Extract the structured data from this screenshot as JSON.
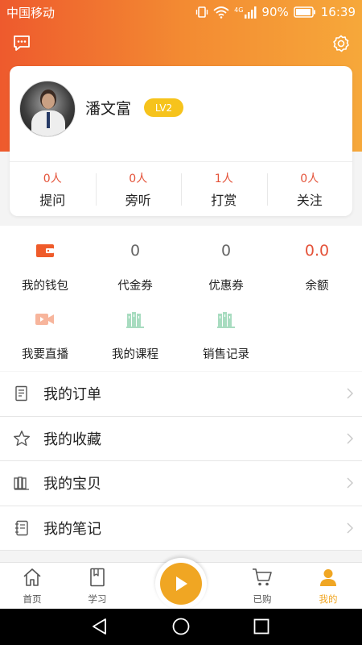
{
  "status_bar": {
    "carrier": "中国移动",
    "network": "4G",
    "battery": "90%",
    "time": "16:39"
  },
  "header": {
    "message_icon": "message-icon",
    "settings_icon": "gear-icon"
  },
  "profile": {
    "name": "潘文富",
    "level": "LV2",
    "stats": [
      {
        "value": "0人",
        "label": "提问"
      },
      {
        "value": "0人",
        "label": "旁听"
      },
      {
        "value": "1人",
        "label": "打赏"
      },
      {
        "value": "0人",
        "label": "关注"
      }
    ]
  },
  "wallet": {
    "row1": [
      {
        "label": "我的钱包",
        "icon": "wallet-icon"
      },
      {
        "value": "0",
        "label": "代金券"
      },
      {
        "value": "0",
        "label": "优惠券"
      },
      {
        "value": "0.0",
        "label": "余额"
      }
    ],
    "row2": [
      {
        "label": "我要直播",
        "icon": "video-camera-icon"
      },
      {
        "label": "我的课程",
        "icon": "books-icon"
      },
      {
        "label": "销售记录",
        "icon": "books-icon"
      }
    ]
  },
  "menu": [
    {
      "label": "我的订单",
      "icon": "order-icon"
    },
    {
      "label": "我的收藏",
      "icon": "star-icon"
    },
    {
      "label": "我的宝贝",
      "icon": "shelf-icon"
    },
    {
      "label": "我的笔记",
      "icon": "notebook-icon"
    }
  ],
  "tabbar": {
    "tabs": [
      {
        "label": "首页",
        "icon": "home-icon"
      },
      {
        "label": "学习",
        "icon": "book-icon"
      },
      {
        "label": "已购",
        "icon": "cart-icon"
      },
      {
        "label": "我的",
        "icon": "person-icon"
      }
    ],
    "active": "我的"
  },
  "colors": {
    "accent": "#f0a623",
    "header_start": "#ee5a2d",
    "header_end": "#f6a83a",
    "stat_value": "#e4533a"
  }
}
